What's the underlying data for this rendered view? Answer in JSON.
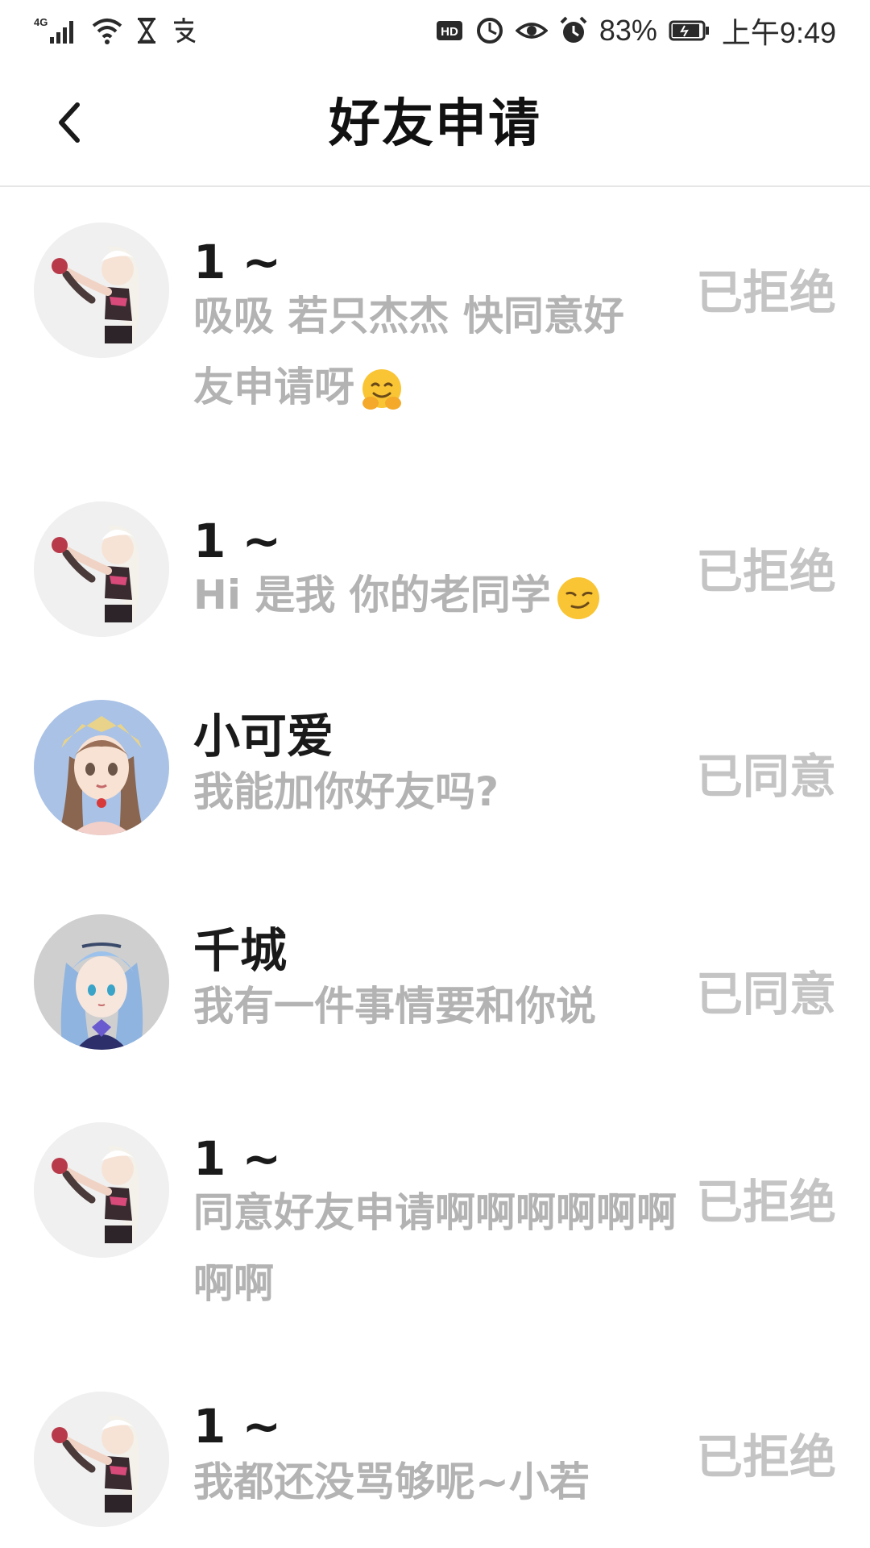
{
  "status_bar": {
    "network": "4G",
    "right_badge_hd": "HD",
    "battery": "83%",
    "time": "上午9:49",
    "icons": [
      "signal-icon",
      "wifi-icon",
      "hourglass-icon",
      "alipay-icon",
      "hd-icon",
      "data-saver-icon",
      "eye-icon",
      "alarm-icon",
      "battery-icon"
    ]
  },
  "nav": {
    "title": "好友申请",
    "back_icon": "chevron-left-icon"
  },
  "requests": [
    {
      "name": "1 ~",
      "message": "吸吸 若只杰杰 快同意好友申请呀",
      "emoji": "hugging-face",
      "status": "已拒绝",
      "avatar": "anime-girl-white-hair"
    },
    {
      "name": "1 ~",
      "message": "Hi 是我 你的老同学",
      "emoji": "smirking-face",
      "status": "已拒绝",
      "avatar": "anime-girl-white-hair"
    },
    {
      "name": "小可爱",
      "message": "我能加你好友吗?",
      "emoji": "",
      "status": "已同意",
      "avatar": "anime-girl-brown-hair"
    },
    {
      "name": "千城",
      "message": "我有一件事情要和你说",
      "emoji": "",
      "status": "已同意",
      "avatar": "anime-girl-blue-hair"
    },
    {
      "name": "1 ~",
      "message": "同意好友申请啊啊啊啊啊啊啊啊",
      "emoji": "",
      "status": "已拒绝",
      "avatar": "anime-girl-white-hair"
    },
    {
      "name": "1 ~",
      "message": "我都还没骂够呢~小若",
      "emoji": "",
      "status": "已拒绝",
      "avatar": "anime-girl-white-hair"
    }
  ],
  "colors": {
    "name_text": "#1a1a1a",
    "message_text": "#b3b3b3",
    "status_text": "#c4c4c4",
    "divider": "#e6e6e6"
  }
}
